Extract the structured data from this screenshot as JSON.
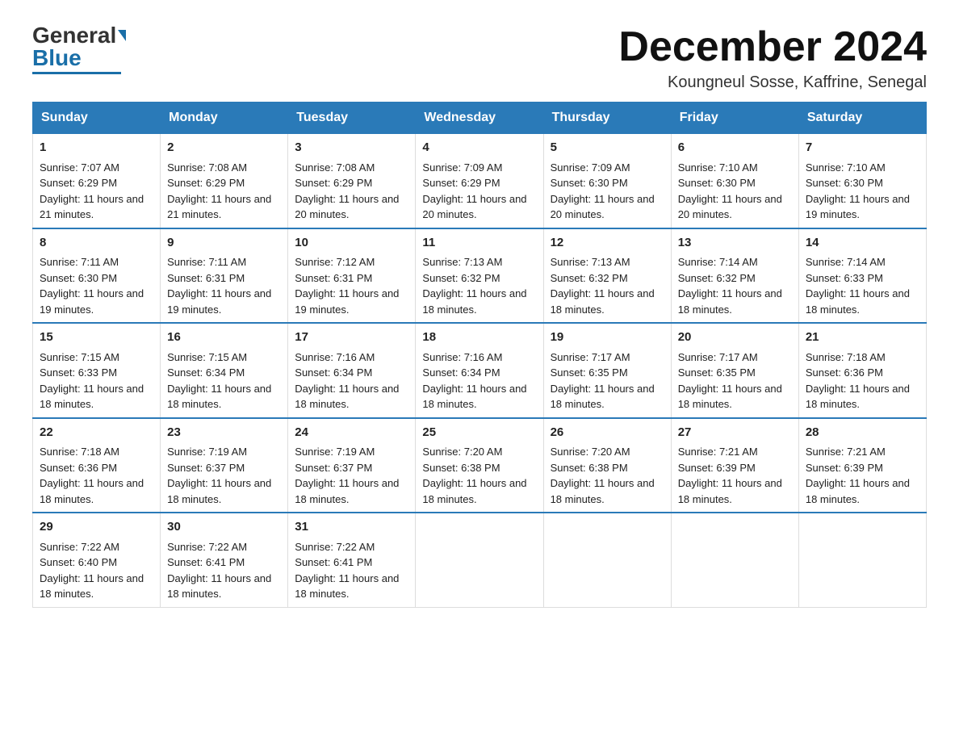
{
  "logo": {
    "general": "General",
    "blue": "Blue"
  },
  "header": {
    "month": "December 2024",
    "location": "Koungneul Sosse, Kaffrine, Senegal"
  },
  "days_of_week": [
    "Sunday",
    "Monday",
    "Tuesday",
    "Wednesday",
    "Thursday",
    "Friday",
    "Saturday"
  ],
  "weeks": [
    [
      {
        "day": "1",
        "sunrise": "7:07 AM",
        "sunset": "6:29 PM",
        "daylight": "11 hours and 21 minutes."
      },
      {
        "day": "2",
        "sunrise": "7:08 AM",
        "sunset": "6:29 PM",
        "daylight": "11 hours and 21 minutes."
      },
      {
        "day": "3",
        "sunrise": "7:08 AM",
        "sunset": "6:29 PM",
        "daylight": "11 hours and 20 minutes."
      },
      {
        "day": "4",
        "sunrise": "7:09 AM",
        "sunset": "6:29 PM",
        "daylight": "11 hours and 20 minutes."
      },
      {
        "day": "5",
        "sunrise": "7:09 AM",
        "sunset": "6:30 PM",
        "daylight": "11 hours and 20 minutes."
      },
      {
        "day": "6",
        "sunrise": "7:10 AM",
        "sunset": "6:30 PM",
        "daylight": "11 hours and 20 minutes."
      },
      {
        "day": "7",
        "sunrise": "7:10 AM",
        "sunset": "6:30 PM",
        "daylight": "11 hours and 19 minutes."
      }
    ],
    [
      {
        "day": "8",
        "sunrise": "7:11 AM",
        "sunset": "6:30 PM",
        "daylight": "11 hours and 19 minutes."
      },
      {
        "day": "9",
        "sunrise": "7:11 AM",
        "sunset": "6:31 PM",
        "daylight": "11 hours and 19 minutes."
      },
      {
        "day": "10",
        "sunrise": "7:12 AM",
        "sunset": "6:31 PM",
        "daylight": "11 hours and 19 minutes."
      },
      {
        "day": "11",
        "sunrise": "7:13 AM",
        "sunset": "6:32 PM",
        "daylight": "11 hours and 18 minutes."
      },
      {
        "day": "12",
        "sunrise": "7:13 AM",
        "sunset": "6:32 PM",
        "daylight": "11 hours and 18 minutes."
      },
      {
        "day": "13",
        "sunrise": "7:14 AM",
        "sunset": "6:32 PM",
        "daylight": "11 hours and 18 minutes."
      },
      {
        "day": "14",
        "sunrise": "7:14 AM",
        "sunset": "6:33 PM",
        "daylight": "11 hours and 18 minutes."
      }
    ],
    [
      {
        "day": "15",
        "sunrise": "7:15 AM",
        "sunset": "6:33 PM",
        "daylight": "11 hours and 18 minutes."
      },
      {
        "day": "16",
        "sunrise": "7:15 AM",
        "sunset": "6:34 PM",
        "daylight": "11 hours and 18 minutes."
      },
      {
        "day": "17",
        "sunrise": "7:16 AM",
        "sunset": "6:34 PM",
        "daylight": "11 hours and 18 minutes."
      },
      {
        "day": "18",
        "sunrise": "7:16 AM",
        "sunset": "6:34 PM",
        "daylight": "11 hours and 18 minutes."
      },
      {
        "day": "19",
        "sunrise": "7:17 AM",
        "sunset": "6:35 PM",
        "daylight": "11 hours and 18 minutes."
      },
      {
        "day": "20",
        "sunrise": "7:17 AM",
        "sunset": "6:35 PM",
        "daylight": "11 hours and 18 minutes."
      },
      {
        "day": "21",
        "sunrise": "7:18 AM",
        "sunset": "6:36 PM",
        "daylight": "11 hours and 18 minutes."
      }
    ],
    [
      {
        "day": "22",
        "sunrise": "7:18 AM",
        "sunset": "6:36 PM",
        "daylight": "11 hours and 18 minutes."
      },
      {
        "day": "23",
        "sunrise": "7:19 AM",
        "sunset": "6:37 PM",
        "daylight": "11 hours and 18 minutes."
      },
      {
        "day": "24",
        "sunrise": "7:19 AM",
        "sunset": "6:37 PM",
        "daylight": "11 hours and 18 minutes."
      },
      {
        "day": "25",
        "sunrise": "7:20 AM",
        "sunset": "6:38 PM",
        "daylight": "11 hours and 18 minutes."
      },
      {
        "day": "26",
        "sunrise": "7:20 AM",
        "sunset": "6:38 PM",
        "daylight": "11 hours and 18 minutes."
      },
      {
        "day": "27",
        "sunrise": "7:21 AM",
        "sunset": "6:39 PM",
        "daylight": "11 hours and 18 minutes."
      },
      {
        "day": "28",
        "sunrise": "7:21 AM",
        "sunset": "6:39 PM",
        "daylight": "11 hours and 18 minutes."
      }
    ],
    [
      {
        "day": "29",
        "sunrise": "7:22 AM",
        "sunset": "6:40 PM",
        "daylight": "11 hours and 18 minutes."
      },
      {
        "day": "30",
        "sunrise": "7:22 AM",
        "sunset": "6:41 PM",
        "daylight": "11 hours and 18 minutes."
      },
      {
        "day": "31",
        "sunrise": "7:22 AM",
        "sunset": "6:41 PM",
        "daylight": "11 hours and 18 minutes."
      },
      null,
      null,
      null,
      null
    ]
  ]
}
